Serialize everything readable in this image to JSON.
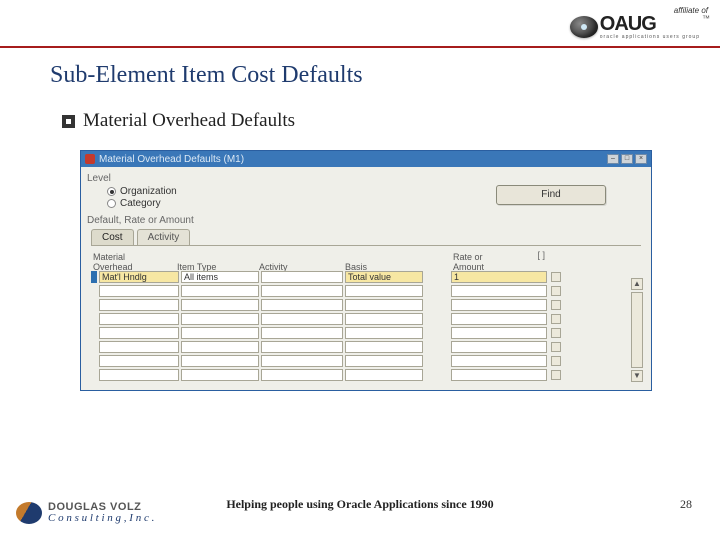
{
  "header": {
    "affiliate": "affiliate of",
    "logo_text": "OAUG",
    "logo_sub": "oracle applications users group",
    "logo_tm": "™"
  },
  "slide": {
    "title": "Sub-Element Item Cost Defaults",
    "bullet": "Material Overhead Defaults"
  },
  "form": {
    "title": "Material Overhead Defaults (M1)",
    "level_label": "Level",
    "radio_org": "Organization",
    "radio_cat": "Category",
    "find_label": "Find",
    "subhead": "Default, Rate or Amount",
    "tab_cost": "Cost",
    "tab_activity": "Activity",
    "columns": {
      "c1a": "Material",
      "c1b": "Overhead",
      "c2": "Item Type",
      "c3": "Activity",
      "c4": "Basis",
      "c5a": "Rate or",
      "c5b": "Amount"
    },
    "row": {
      "overhead": "Mat'l Hndlg",
      "item_type": "All items",
      "activity": "",
      "basis": "Total value",
      "rate": "1"
    },
    "scroll_indicator": "[ ]"
  },
  "footer": {
    "brand_top": "DOUGLAS VOLZ",
    "brand_bot": "C o n s u l t i n g ,  I n c .",
    "tagline": "Helping people using Oracle Applications since 1990",
    "page": "28"
  }
}
